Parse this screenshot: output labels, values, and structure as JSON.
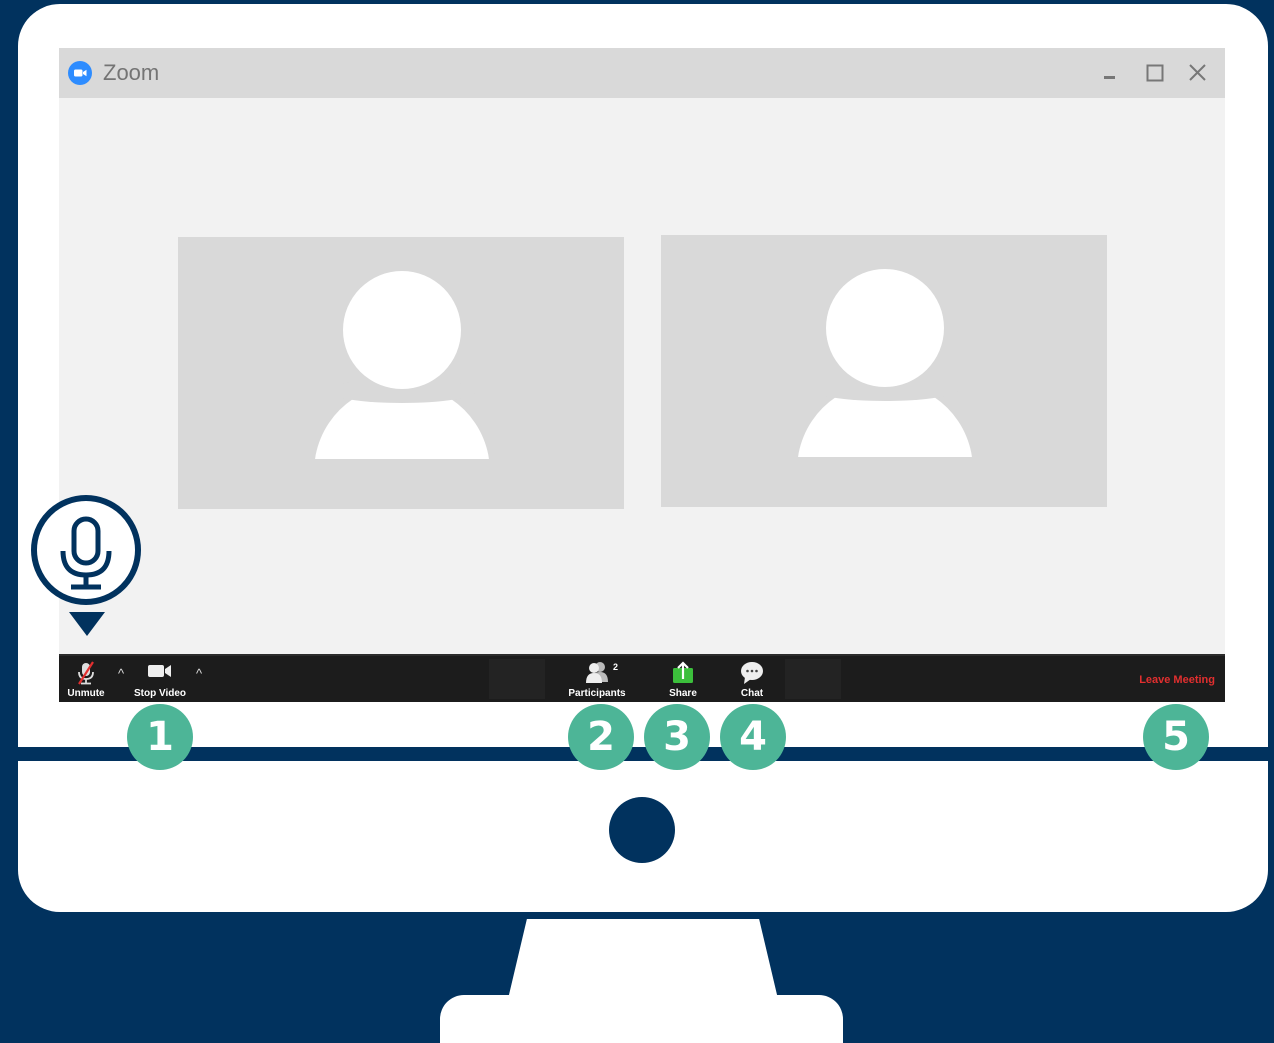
{
  "window": {
    "title": "Zoom",
    "icons": [
      "zoom-logo-icon",
      "minimize-icon",
      "maximize-icon",
      "close-icon"
    ]
  },
  "participants_grid": [
    {
      "icon": "user-avatar-icon"
    },
    {
      "icon": "user-avatar-icon"
    }
  ],
  "toolbar": {
    "unmute_label": "Unmute",
    "stop_video_label": "Stop Video",
    "participants_label": "Participants",
    "participants_count": "2",
    "share_label": "Share",
    "chat_label": "Chat",
    "leave_label": "Leave Meeting"
  },
  "callouts": {
    "mic_icon": "microphone-icon",
    "steps": [
      "1",
      "2",
      "3",
      "4",
      "5"
    ]
  },
  "colors": {
    "background": "#01325e",
    "step_badge": "#4db597",
    "leave_text": "#e22f2f",
    "share_green": "#3cbf3c",
    "zoom_blue": "#2d8cff"
  }
}
